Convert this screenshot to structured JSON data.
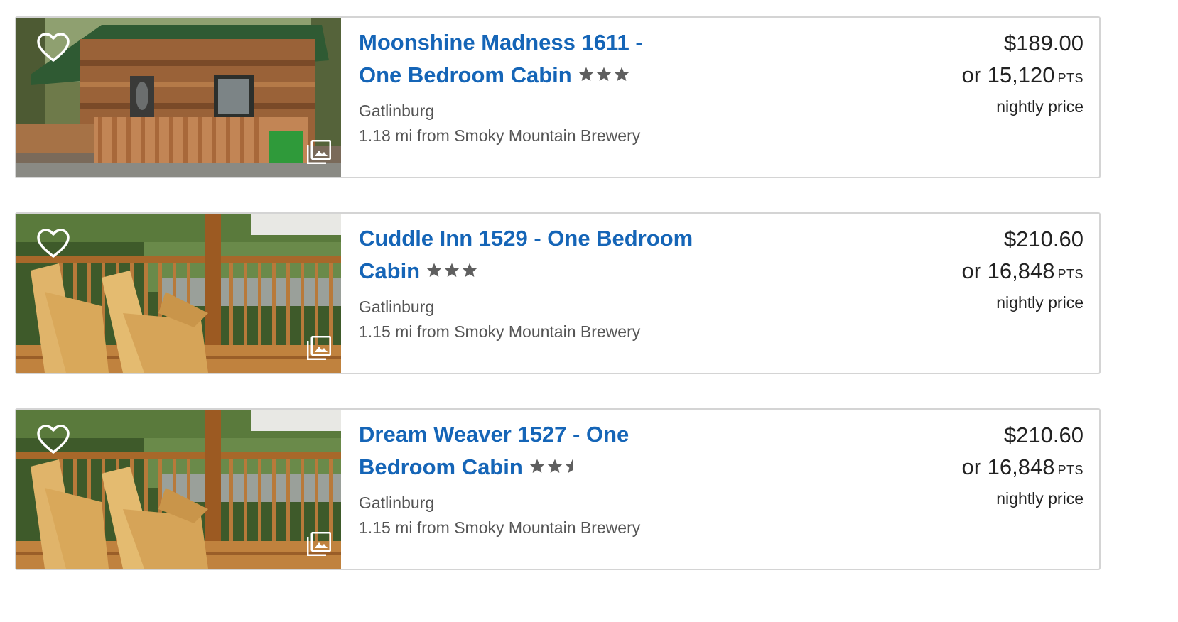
{
  "listings": [
    {
      "title_line1": "Moonshine Madness 1611 -",
      "title_line2": "One Bedroom Cabin",
      "rating": 3,
      "city": "Gatlinburg",
      "distance": "1.18 mi from Smoky Mountain Brewery",
      "price": "$189.00",
      "points_prefix": "or 15,120",
      "points_unit": "PTS",
      "price_note": "nightly price",
      "photo": "cabin-exterior"
    },
    {
      "title_line1": "Cuddle Inn 1529 - One Bedroom",
      "title_line2": "Cabin",
      "rating": 3,
      "city": "Gatlinburg",
      "distance": "1.15 mi from Smoky Mountain Brewery",
      "price": "$210.60",
      "points_prefix": "or 16,848",
      "points_unit": "PTS",
      "price_note": "nightly price",
      "photo": "porch-rocking-chairs"
    },
    {
      "title_line1": "Dream Weaver 1527 - One",
      "title_line2": "Bedroom Cabin",
      "rating": 2.5,
      "city": "Gatlinburg",
      "distance": "1.15 mi from Smoky Mountain Brewery",
      "price": "$210.60",
      "points_prefix": "or 16,848",
      "points_unit": "PTS",
      "price_note": "nightly price",
      "photo": "porch-rocking-chairs"
    }
  ],
  "icons": {
    "favorite": "heart-outline-icon",
    "gallery": "photo-gallery-icon",
    "rating": "star-icon"
  },
  "colors": {
    "title": "#1565b7",
    "star": "#5f5f5f",
    "border": "#d4d4d4"
  }
}
